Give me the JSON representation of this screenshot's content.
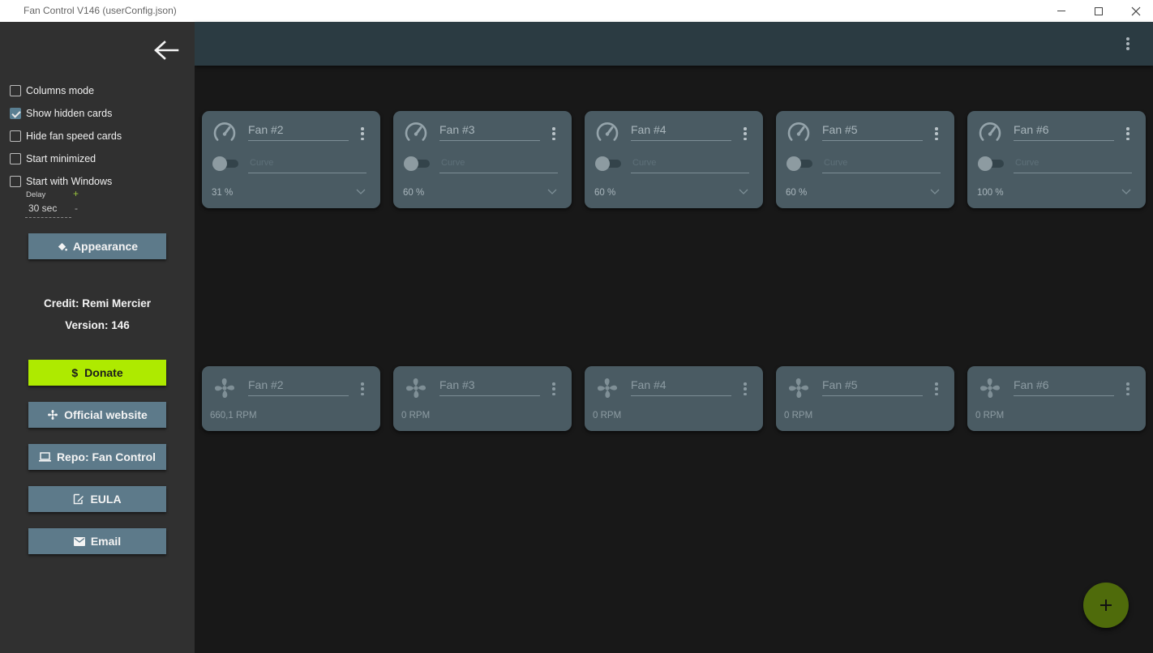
{
  "window": {
    "title": "Fan Control V146 (userConfig.json)"
  },
  "drawer": {
    "options": [
      {
        "label": "Columns mode",
        "checked": false
      },
      {
        "label": "Show hidden cards",
        "checked": true
      },
      {
        "label": "Hide fan speed cards",
        "checked": false
      },
      {
        "label": "Start minimized",
        "checked": false
      },
      {
        "label": "Start with Windows",
        "checked": false
      }
    ],
    "delay": {
      "label": "Delay",
      "value": "30 sec",
      "plus": "+",
      "minus": "-"
    },
    "appearance_label": "Appearance",
    "credit": "Credit: Remi Mercier",
    "version": "Version: 146",
    "donate_label": "Donate",
    "website_label": "Official website",
    "repo_label": "Repo: Fan Control",
    "eula_label": "EULA",
    "email_label": "Email"
  },
  "control_cards": [
    {
      "name": "Fan #2",
      "curve_placeholder": "Curve",
      "percent": "31 %"
    },
    {
      "name": "Fan #3",
      "curve_placeholder": "Curve",
      "percent": "60 %"
    },
    {
      "name": "Fan #4",
      "curve_placeholder": "Curve",
      "percent": "60 %"
    },
    {
      "name": "Fan #5",
      "curve_placeholder": "Curve",
      "percent": "60 %"
    },
    {
      "name": "Fan #6",
      "curve_placeholder": "Curve",
      "percent": "100 %"
    }
  ],
  "speed_cards": [
    {
      "name": "Fan #2",
      "rpm": "660,1 RPM"
    },
    {
      "name": "Fan #3",
      "rpm": "0 RPM"
    },
    {
      "name": "Fan #4",
      "rpm": "0 RPM"
    },
    {
      "name": "Fan #5",
      "rpm": "0 RPM"
    },
    {
      "name": "Fan #6",
      "rpm": "0 RPM"
    }
  ],
  "icons": {
    "back": "arrow-left-icon",
    "more": "more-vert-icon",
    "control": "speedometer-icon",
    "speed": "fan-icon",
    "add": "plus-icon"
  },
  "colors": {
    "accent": "#aeea00",
    "card": "#4a5b63",
    "appbar": "#2b3b42",
    "drawer": "#303030",
    "fab": "#4f6b0b",
    "button": "#5d7a8a"
  }
}
